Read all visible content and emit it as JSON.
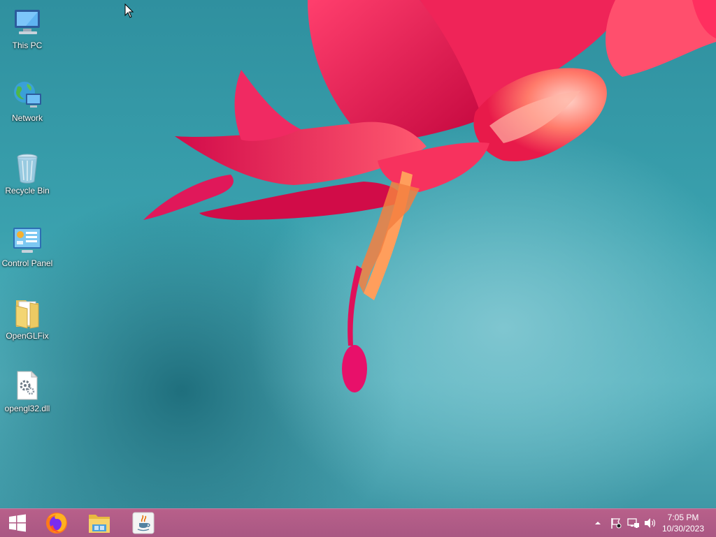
{
  "desktop": {
    "icons": [
      {
        "label": "This PC",
        "icon": "computer-icon"
      },
      {
        "label": "Network",
        "icon": "network-icon"
      },
      {
        "label": "Recycle Bin",
        "icon": "recycle-bin-icon"
      },
      {
        "label": "Control Panel",
        "icon": "control-panel-icon"
      },
      {
        "label": "OpenGLFix",
        "icon": "folder-icon"
      },
      {
        "label": "opengl32.dll",
        "icon": "dll-file-icon"
      }
    ]
  },
  "taskbar": {
    "start_icon": "windows-logo-icon",
    "pinned": [
      {
        "name": "Firefox",
        "icon": "firefox-icon"
      },
      {
        "name": "File Explorer",
        "icon": "file-explorer-icon"
      },
      {
        "name": "Java",
        "icon": "java-icon"
      }
    ],
    "tray_icons": [
      "show-hidden-icons-chevron",
      "action-center-flag-icon",
      "network-status-icon",
      "volume-icon"
    ],
    "clock": {
      "time": "7:05 PM",
      "date": "10/30/2023"
    }
  },
  "colors": {
    "taskbar": "#b35d88",
    "wallpaper_teal": "#3a9aa8",
    "flower_pink": "#e0104e"
  }
}
